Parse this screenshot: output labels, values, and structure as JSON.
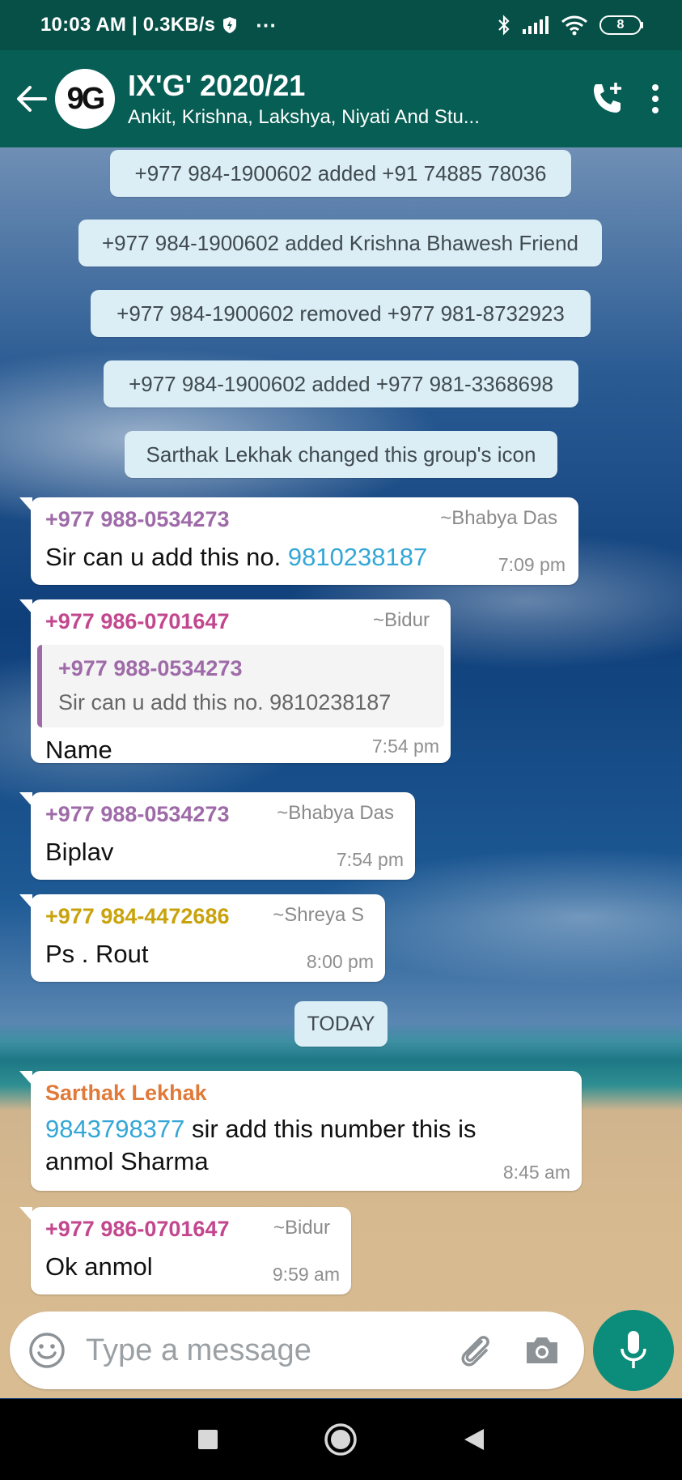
{
  "status_bar": {
    "time_speed": "10:03 AM | 0.3KB/s",
    "more": "···",
    "battery": "8"
  },
  "header": {
    "avatar_text": "9G",
    "title": "IX'G' 2020/21",
    "subtitle": "Ankit, Krishna, Lakshya, Niyati And Stu..."
  },
  "system_messages": [
    "+977 984-1900602 added +91 74885 78036",
    "+977 984-1900602 added Krishna Bhawesh Friend",
    "+977 984-1900602 removed +977 981-8732923",
    "+977 984-1900602 added +977 981-3368698",
    "Sarthak Lekhak changed this group's icon"
  ],
  "date_divider": "TODAY",
  "messages": [
    {
      "sender": "+977 988-0534273",
      "alias": "~Bhabya Das",
      "text": "Sir can u add this no. ",
      "link": "9810238187",
      "time": "7:09 pm",
      "sender_color": "#9e6aa8"
    },
    {
      "sender": "+977 986-0701647",
      "alias": "~Bidur",
      "quote_sender": "+977 988-0534273",
      "quote_text": "Sir can u add this no. 9810238187",
      "text": "Name",
      "time": "7:54 pm",
      "sender_color": "#c2478e"
    },
    {
      "sender": "+977 988-0534273",
      "alias": "~Bhabya Das",
      "text": "Biplav",
      "time": "7:54 pm",
      "sender_color": "#9e6aa8"
    },
    {
      "sender": "+977 984-4472686",
      "alias": "~Shreya S",
      "text": "Ps . Rout",
      "time": "8:00 pm",
      "sender_color": "#c9a30c"
    },
    {
      "sender": "Sarthak Lekhak",
      "link": "9843798377",
      "text_line1": " sir add this number this is",
      "text_line2": "anmol Sharma",
      "time": "8:45 am",
      "sender_color": "#e07a3a"
    },
    {
      "sender": "+977 986-0701647",
      "alias": "~Bidur",
      "text": "Ok anmol",
      "time": "9:59 am",
      "sender_color": "#c2478e"
    }
  ],
  "input": {
    "placeholder": "Type a message"
  },
  "colors": {
    "app_bar": "#075e54",
    "status_bar": "#075047",
    "link": "#34a7d6",
    "mic_button": "#0c8c7a"
  }
}
